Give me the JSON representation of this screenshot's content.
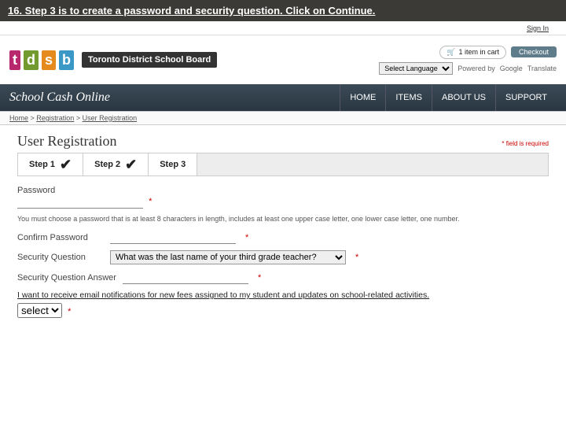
{
  "instruction": "16. Step 3 is to create a password and security question.  Click on Continue.",
  "toplink": {
    "signin": "Sign In"
  },
  "logo": {
    "t": "t",
    "d": "d",
    "s": "s",
    "b": "b"
  },
  "brand": "Toronto District School Board",
  "cart": {
    "label": "1 item in cart",
    "checkout": "Checkout"
  },
  "lang": {
    "select": "Select Language",
    "powered": "Powered by",
    "google": "Google",
    "translate": "Translate"
  },
  "site": "School Cash Online",
  "nav": {
    "home": "HOME",
    "items": "ITEMS",
    "about": "ABOUT US",
    "support": "SUPPORT"
  },
  "crumb": {
    "home": "Home",
    "reg": "Registration",
    "user": "User Registration"
  },
  "page": {
    "title": "User Registration",
    "req": "* field is required"
  },
  "steps": {
    "s1": "Step 1",
    "s2": "Step 2",
    "s3": "Step 3"
  },
  "form": {
    "password_label": "Password",
    "password_hint": "You must choose a password that is at least 8 characters in length, includes at least one upper case letter, one lower case letter, one number.",
    "confirm_label": "Confirm Password",
    "sq_label": "Security Question",
    "sq_value": "What was the last name of your third grade teacher?",
    "sqa_label": "Security Question Answer",
    "notif_text": "I want to receive email notifications for new fees assigned to my student and updates on school-related activities.",
    "select_value": "select"
  }
}
